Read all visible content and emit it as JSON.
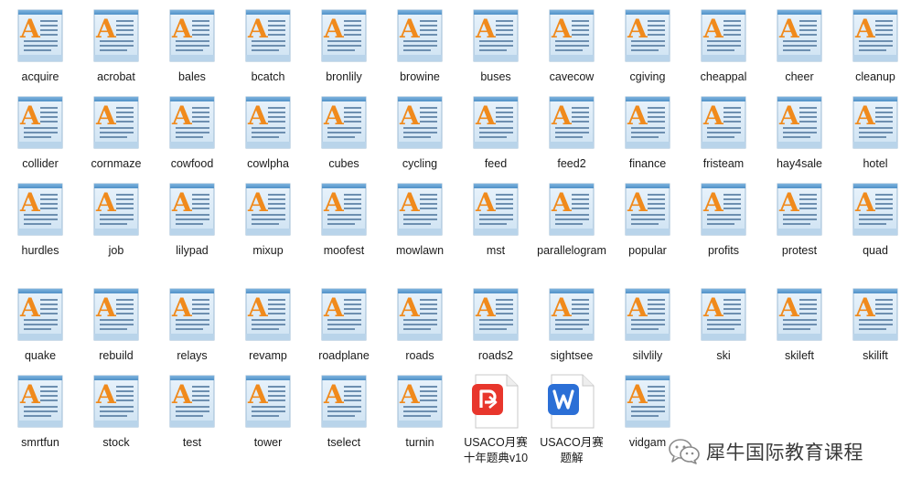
{
  "files": [
    {
      "name": "acquire",
      "type": "txt"
    },
    {
      "name": "acrobat",
      "type": "txt"
    },
    {
      "name": "bales",
      "type": "txt"
    },
    {
      "name": "bcatch",
      "type": "txt"
    },
    {
      "name": "bronlily",
      "type": "txt"
    },
    {
      "name": "browine",
      "type": "txt"
    },
    {
      "name": "buses",
      "type": "txt"
    },
    {
      "name": "cavecow",
      "type": "txt"
    },
    {
      "name": "cgiving",
      "type": "txt"
    },
    {
      "name": "cheappal",
      "type": "txt"
    },
    {
      "name": "cheer",
      "type": "txt"
    },
    {
      "name": "cleanup",
      "type": "txt"
    },
    {
      "name": "collider",
      "type": "txt"
    },
    {
      "name": "cornmaze",
      "type": "txt"
    },
    {
      "name": "cowfood",
      "type": "txt"
    },
    {
      "name": "cowlpha",
      "type": "txt"
    },
    {
      "name": "cubes",
      "type": "txt"
    },
    {
      "name": "cycling",
      "type": "txt"
    },
    {
      "name": "feed",
      "type": "txt"
    },
    {
      "name": "feed2",
      "type": "txt"
    },
    {
      "name": "finance",
      "type": "txt"
    },
    {
      "name": "fristeam",
      "type": "txt"
    },
    {
      "name": "hay4sale",
      "type": "txt"
    },
    {
      "name": "hotel",
      "type": "txt"
    },
    {
      "name": "hurdles",
      "type": "txt"
    },
    {
      "name": "job",
      "type": "txt"
    },
    {
      "name": "lilypad",
      "type": "txt"
    },
    {
      "name": "mixup",
      "type": "txt"
    },
    {
      "name": "moofest",
      "type": "txt"
    },
    {
      "name": "mowlawn",
      "type": "txt"
    },
    {
      "name": "mst",
      "type": "txt"
    },
    {
      "name": "parallelogram",
      "type": "txt"
    },
    {
      "name": "popular",
      "type": "txt"
    },
    {
      "name": "profits",
      "type": "txt"
    },
    {
      "name": "protest",
      "type": "txt"
    },
    {
      "name": "quad",
      "type": "txt"
    },
    {
      "name": "quake",
      "type": "txt"
    },
    {
      "name": "rebuild",
      "type": "txt"
    },
    {
      "name": "relays",
      "type": "txt"
    },
    {
      "name": "revamp",
      "type": "txt"
    },
    {
      "name": "roadplane",
      "type": "txt"
    },
    {
      "name": "roads",
      "type": "txt"
    },
    {
      "name": "roads2",
      "type": "txt"
    },
    {
      "name": "sightsee",
      "type": "txt"
    },
    {
      "name": "silvlily",
      "type": "txt"
    },
    {
      "name": "ski",
      "type": "txt"
    },
    {
      "name": "skileft",
      "type": "txt"
    },
    {
      "name": "skilift",
      "type": "txt"
    },
    {
      "name": "smrtfun",
      "type": "txt"
    },
    {
      "name": "stock",
      "type": "txt"
    },
    {
      "name": "test",
      "type": "txt"
    },
    {
      "name": "tower",
      "type": "txt"
    },
    {
      "name": "tselect",
      "type": "txt"
    },
    {
      "name": "turnin",
      "type": "txt"
    },
    {
      "name": "USACO月赛十年题典v10",
      "type": "pdf"
    },
    {
      "name": "USACO月赛题解",
      "type": "doc"
    },
    {
      "name": "vidgam",
      "type": "txt"
    }
  ],
  "watermark": {
    "text": "犀牛国际教育课程",
    "icon": "wechat-icon"
  },
  "colors": {
    "letter_orange": "#f08a1c",
    "pdf_red": "#e8362c",
    "doc_blue": "#2b6fd6",
    "label_text": "#1a1a1a"
  }
}
